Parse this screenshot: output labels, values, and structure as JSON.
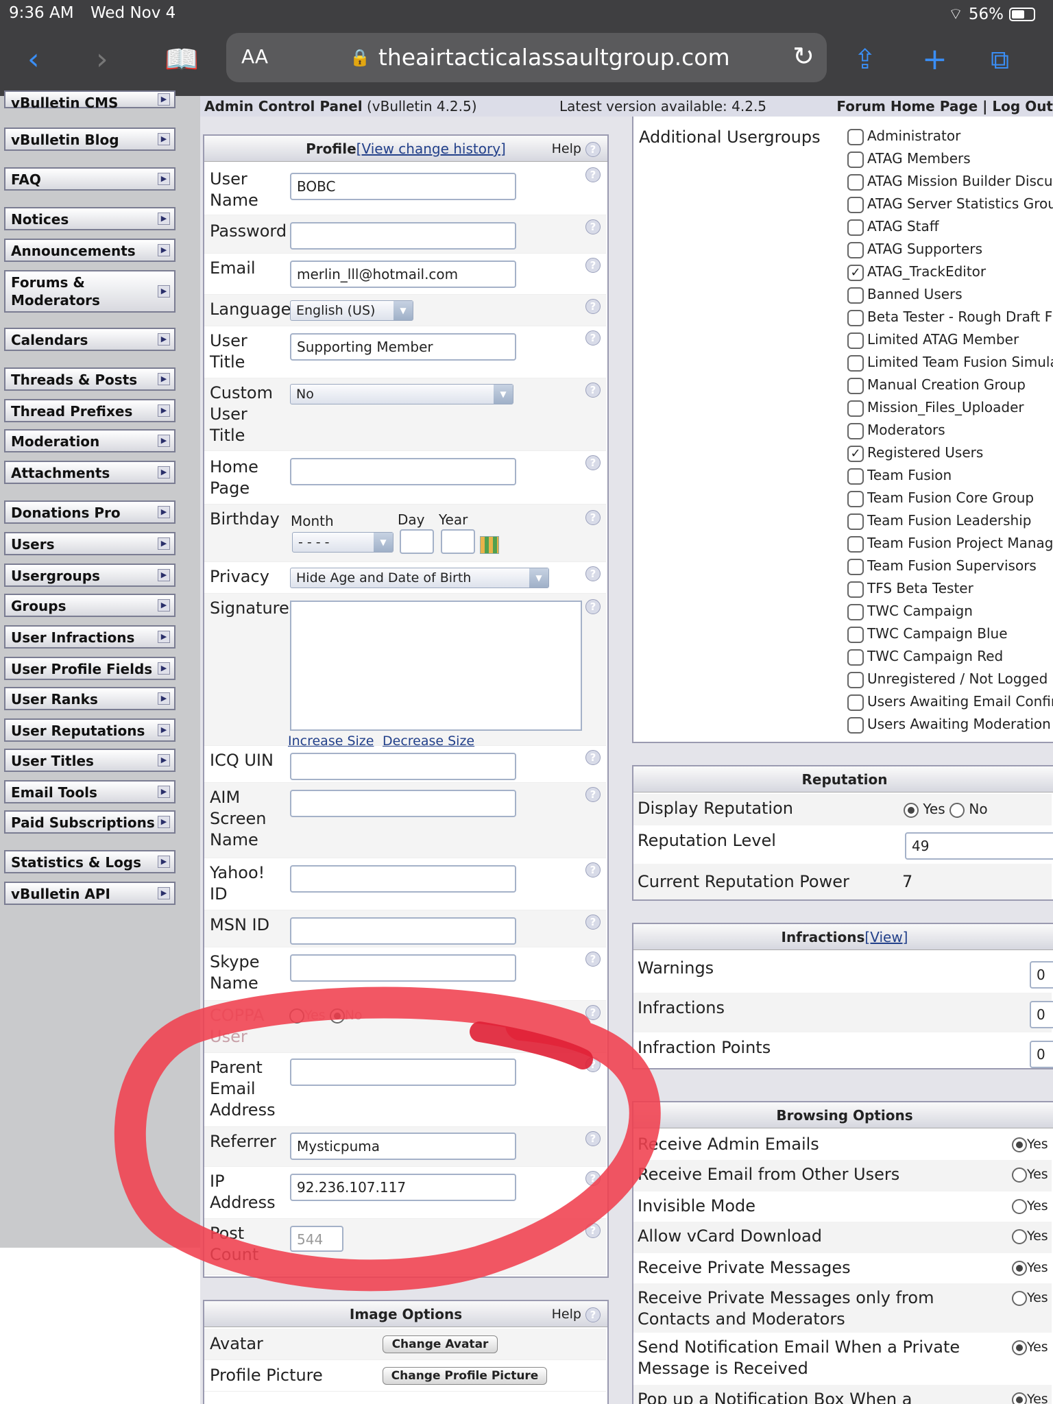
{
  "status_bar": {
    "time": "9:36 AM",
    "date": "Wed Nov 4",
    "battery": "56%"
  },
  "browser": {
    "text_size_label": "AA",
    "url": "theairtacticalassaultgroup.com"
  },
  "sidebar": {
    "items": [
      "vBulletin CMS",
      "vBulletin Blog",
      "FAQ",
      "Notices",
      "Announcements",
      "Forums & Moderators",
      "Calendars",
      "Threads & Posts",
      "Thread Prefixes",
      "Moderation",
      "Attachments",
      "Donations Pro",
      "Users",
      "Usergroups",
      "Groups",
      "User Infractions",
      "User Profile Fields",
      "User Ranks",
      "User Reputations",
      "User Titles",
      "Email Tools",
      "Paid Subscriptions",
      "Statistics & Logs",
      "vBulletin API"
    ]
  },
  "header": {
    "title": "Admin Control Panel",
    "version": "(vBulletin 4.2.5)",
    "latest": "Latest version available: 4.2.5",
    "links": "Forum Home Page | Log Out"
  },
  "profile": {
    "title": "Profile",
    "history_link": "[View change history]",
    "help": "Help",
    "q": "?",
    "fields": {
      "username": {
        "label": "User Name",
        "value": "BOBC"
      },
      "password": {
        "label": "Password",
        "value": ""
      },
      "email": {
        "label": "Email",
        "value": "merlin_lll@hotmail.com"
      },
      "language": {
        "label": "Language",
        "value": "English (US)"
      },
      "usertitle": {
        "label": "User Title",
        "value": "Supporting Member"
      },
      "customtitle": {
        "label": "Custom User Title",
        "value": "No"
      },
      "homepage": {
        "label": "Home Page",
        "value": ""
      },
      "birthday": {
        "label": "Birthday",
        "month_label": "Month",
        "day_label": "Day",
        "year_label": "Year",
        "month_value": "- - - -"
      },
      "privacy": {
        "label": "Privacy",
        "value": "Hide Age and Date of Birth"
      },
      "signature": {
        "label": "Signature",
        "increase": "Increase Size",
        "decrease": "Decrease Size"
      },
      "icq": {
        "label": "ICQ UIN"
      },
      "aim": {
        "label": "AIM Screen Name"
      },
      "yahoo": {
        "label": "Yahoo! ID"
      },
      "msn": {
        "label": "MSN ID"
      },
      "skype": {
        "label": "Skype Name"
      },
      "coppa": {
        "label": "COPPA User",
        "yes": "Yes",
        "no": "No"
      },
      "parent_email": {
        "label": "Parent Email Address"
      },
      "referrer": {
        "label": "Referrer",
        "value": "Mysticpuma"
      },
      "ip": {
        "label": "IP Address",
        "value": "92.236.107.117"
      },
      "postcount": {
        "label": "Post Count",
        "value": "544"
      }
    }
  },
  "image_options": {
    "title": "Image Options",
    "help": "Help",
    "avatar_label": "Avatar",
    "avatar_btn": "Change Avatar",
    "picture_label": "Profile Picture",
    "picture_btn": "Change Profile Picture"
  },
  "usergroups": {
    "label": "Additional Usergroups",
    "items": [
      {
        "name": "Administrator",
        "checked": false
      },
      {
        "name": "ATAG Members",
        "checked": false
      },
      {
        "name": "ATAG Mission Builder Discus",
        "checked": false
      },
      {
        "name": "ATAG Server Statistics Grou",
        "checked": false
      },
      {
        "name": "ATAG Staff",
        "checked": false
      },
      {
        "name": "ATAG Supporters",
        "checked": false
      },
      {
        "name": "ATAG_TrackEditor",
        "checked": true
      },
      {
        "name": "Banned Users",
        "checked": false
      },
      {
        "name": "Beta Tester - Rough Draft F",
        "checked": false
      },
      {
        "name": "Limited ATAG Member",
        "checked": false
      },
      {
        "name": "Limited Team Fusion Simula",
        "checked": false
      },
      {
        "name": "Manual Creation Group",
        "checked": false
      },
      {
        "name": "Mission_Files_Uploader",
        "checked": false
      },
      {
        "name": "Moderators",
        "checked": false
      },
      {
        "name": "Registered Users",
        "checked": true
      },
      {
        "name": "Team Fusion",
        "checked": false
      },
      {
        "name": "Team Fusion Core Group",
        "checked": false
      },
      {
        "name": "Team Fusion Leadership",
        "checked": false
      },
      {
        "name": "Team Fusion Project Manag",
        "checked": false
      },
      {
        "name": "Team Fusion Supervisors",
        "checked": false
      },
      {
        "name": "TFS Beta Tester",
        "checked": false
      },
      {
        "name": "TWC Campaign",
        "checked": false
      },
      {
        "name": "TWC Campaign Blue",
        "checked": false
      },
      {
        "name": "TWC Campaign Red",
        "checked": false
      },
      {
        "name": "Unregistered / Not Logged I",
        "checked": false
      },
      {
        "name": "Users Awaiting Email Confir",
        "checked": false
      },
      {
        "name": "Users Awaiting Moderation",
        "checked": false
      }
    ]
  },
  "reputation": {
    "title": "Reputation",
    "display_label": "Display Reputation",
    "yes": "Yes",
    "no": "No",
    "level_label": "Reputation Level",
    "level_value": "49",
    "power_label": "Current Reputation Power",
    "power_value": "7"
  },
  "infractions": {
    "title": "Infractions",
    "view_link": "[View]",
    "warnings_label": "Warnings",
    "warnings_value": "0",
    "infractions_label": "Infractions",
    "infractions_value": "0",
    "points_label": "Infraction Points",
    "points_value": "0"
  },
  "browsing": {
    "title": "Browsing Options",
    "yes": "Yes",
    "items": [
      {
        "label": "Receive Admin Emails",
        "yes_on": true
      },
      {
        "label": "Receive Email from Other Users",
        "yes_on": false
      },
      {
        "label": "Invisible Mode",
        "yes_on": false
      },
      {
        "label": "Allow vCard Download",
        "yes_on": false
      },
      {
        "label": "Receive Private Messages",
        "yes_on": true
      },
      {
        "label": "Receive Private Messages only from Contacts and Moderators",
        "yes_on": false
      },
      {
        "label": "Send Notification Email When a Private Message is Received",
        "yes_on": true
      },
      {
        "label": "Pop up a Notification Box When a Private",
        "yes_on": true
      }
    ]
  },
  "colors": {
    "annotation": "#f0404e",
    "sidebar_bg": "#c9cacc",
    "link": "#22408a"
  }
}
